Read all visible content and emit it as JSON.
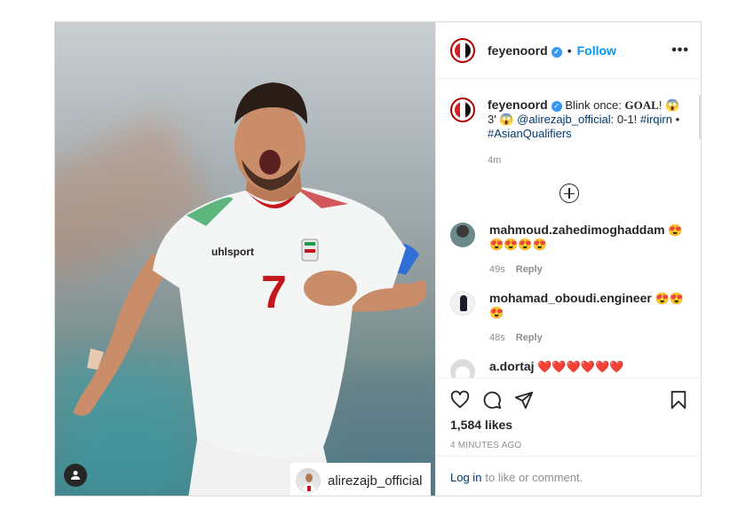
{
  "post": {
    "username": "feyenoord",
    "follow_label": "Follow",
    "separator": "•",
    "more_label": "•••"
  },
  "photo": {
    "tag_username": "alirezajb_official"
  },
  "caption": {
    "username": "feyenoord",
    "text_before": "Blink once: ",
    "goal": "GOAL",
    "text_after_goal": "! 😱 3' 😱 ",
    "mention": "@alirezajb_official",
    "text_mid": ": 0-1! ",
    "hashtag1": "#irqirn",
    "text_dot": " • ",
    "hashtag2": "#AsianQualifiers",
    "time": "4m"
  },
  "comments": [
    {
      "username": "mahmoud.zahedimoghaddam",
      "text": "😍😍😍😍😍",
      "time": "49s",
      "reply": "Reply"
    },
    {
      "username": "mohamad_oboudi.engineer",
      "text": "😍😍😍",
      "time": "48s",
      "reply": "Reply"
    },
    {
      "username": "a.dortaj",
      "text": "❤️❤️❤️❤️❤️❤️"
    }
  ],
  "actions": {
    "likes": "1,584 likes",
    "timestamp": "4 MINUTES AGO"
  },
  "login": {
    "link": "Log in",
    "text": "to like or comment."
  },
  "colors": {
    "follow": "#0095f6",
    "link": "#00376b",
    "verified": "#3897f0",
    "jersey_number": "#c4161c"
  },
  "player_photo": {
    "shirt_brand": "uhlsport",
    "shirt_number": "7"
  }
}
